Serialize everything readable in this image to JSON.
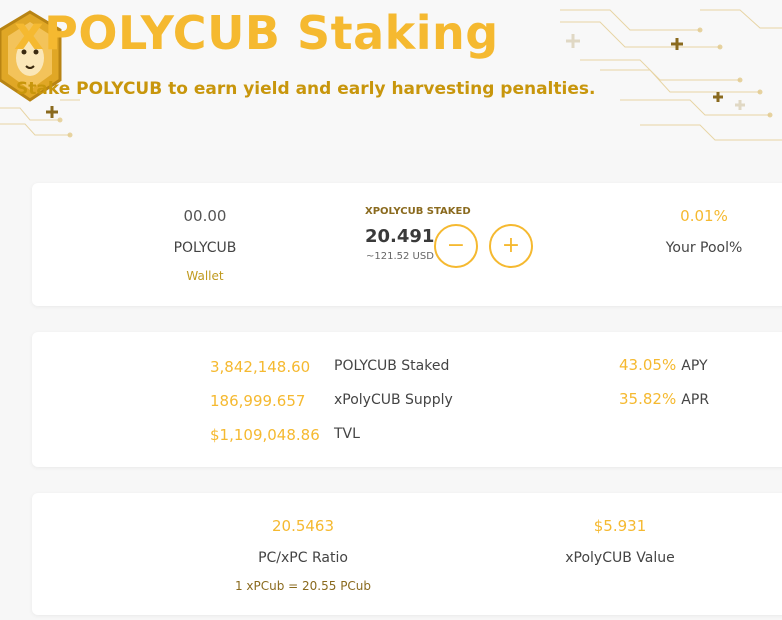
{
  "header": {
    "title": "xPOLYCUB Staking",
    "subtitle": "Stake POLYCUB to earn yield and early harvesting penalties."
  },
  "wallet_card": {
    "wallet_amount": "00.00",
    "wallet_token": "POLYCUB",
    "wallet_label": "Wallet",
    "staked_label": "XPOLYCUB STAKED",
    "staked_amount": "20.491",
    "staked_usd": "~121.52 USD",
    "decrease_icon": "minus-icon",
    "increase_icon": "plus-icon",
    "pool_percent": "0.01%",
    "pool_label": "Your Pool%"
  },
  "stats_card": {
    "rows": [
      {
        "value": "3,842,148.60",
        "label": "POLYCUB Staked"
      },
      {
        "value": "186,999.657",
        "label": "xPolyCUB Supply"
      },
      {
        "value": "$1,109,048.86",
        "label": "TVL"
      }
    ],
    "rates": [
      {
        "value": "43.05%",
        "label": "APY"
      },
      {
        "value": "35.82%",
        "label": "APR"
      }
    ]
  },
  "ratio_card": {
    "ratio_value": "20.5463",
    "ratio_label": "PC/xPC Ratio",
    "ratio_note": "1 xPCub = 20.55 PCub",
    "xpolycub_value": "$5.931",
    "xpolycub_value_label": "xPolyCUB Value"
  },
  "colors": {
    "accent": "#f5b930",
    "accent_dark": "#c8960c",
    "background": "#f7f7f7",
    "card": "#ffffff"
  }
}
